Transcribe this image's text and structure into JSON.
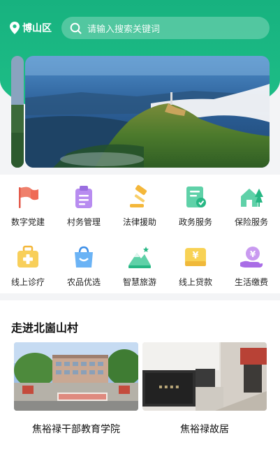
{
  "location": {
    "label": "博山区",
    "icon": "map-pin-icon"
  },
  "search": {
    "placeholder": "请输入搜索关键词",
    "icon": "search-icon"
  },
  "services": [
    {
      "label": "数字党建",
      "icon": "red-flag-icon"
    },
    {
      "label": "村务管理",
      "icon": "clipboard-icon"
    },
    {
      "label": "法律援助",
      "icon": "gavel-icon"
    },
    {
      "label": "政务服务",
      "icon": "certificate-icon"
    },
    {
      "label": "保险服务",
      "icon": "house-tree-icon"
    },
    {
      "label": "线上诊疗",
      "icon": "medical-kit-icon"
    },
    {
      "label": "农品优选",
      "icon": "shopping-bag-icon"
    },
    {
      "label": "智慧旅游",
      "icon": "mountain-icon"
    },
    {
      "label": "线上贷款",
      "icon": "yuan-wallet-icon"
    },
    {
      "label": "生活缴费",
      "icon": "yuan-hand-icon"
    }
  ],
  "section": {
    "title": "走进北崮山村",
    "cards": [
      {
        "caption": "焦裕禄干部教育学院"
      },
      {
        "caption": "焦裕禄故居"
      }
    ]
  },
  "colors": {
    "brand": "#1fbf88"
  }
}
